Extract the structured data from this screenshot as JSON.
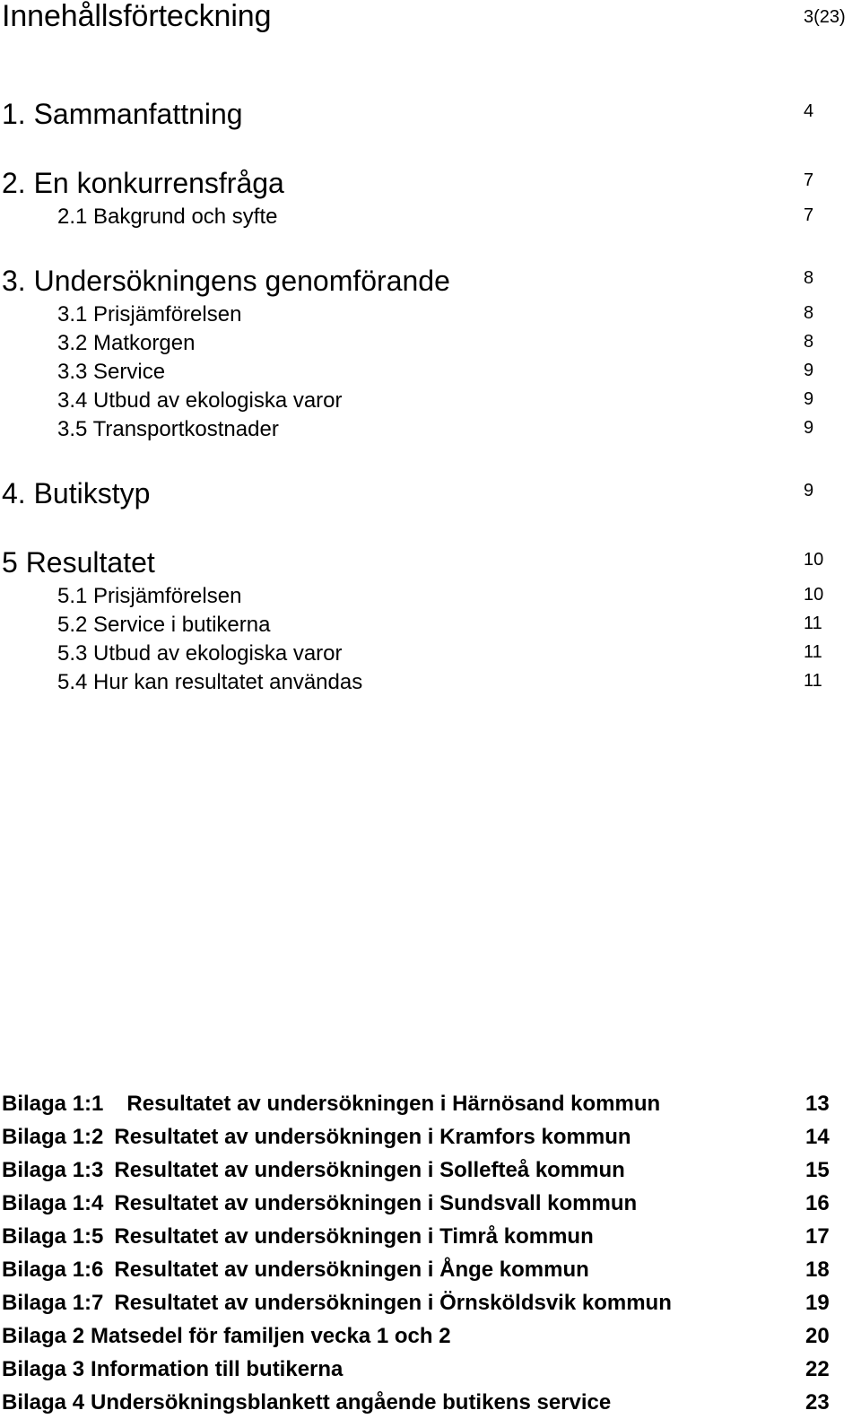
{
  "document": {
    "title": "Innehållsförteckning",
    "page_indicator": "3(23)"
  },
  "toc": {
    "entries": [
      {
        "label": "1. Sammanfattning",
        "page": "4",
        "level": 1
      },
      {
        "label": "2. En konkurrensfråga",
        "page": "7",
        "level": 1
      },
      {
        "label": "2.1 Bakgrund och syfte",
        "page": "7",
        "level": 2
      },
      {
        "label": "3. Undersökningens genomförande",
        "page": "8",
        "level": 1
      },
      {
        "label": "3.1 Prisjämförelsen",
        "page": "8",
        "level": 2
      },
      {
        "label": "3.2 Matkorgen",
        "page": "8",
        "level": 2
      },
      {
        "label": "3.3 Service",
        "page": "9",
        "level": 2
      },
      {
        "label": "3.4 Utbud av ekologiska varor",
        "page": "9",
        "level": 2
      },
      {
        "label": "3.5 Transportkostnader",
        "page": "9",
        "level": 2
      },
      {
        "label": "4. Butikstyp",
        "page": "9",
        "level": 1
      },
      {
        "label": "5 Resultatet",
        "page": "10",
        "level": 1
      },
      {
        "label": "5.1 Prisjämförelsen",
        "page": "10",
        "level": 2
      },
      {
        "label": "5.2 Service i butikerna",
        "page": "11",
        "level": 2
      },
      {
        "label": "5.3 Utbud av ekologiska varor",
        "page": "11",
        "level": 2
      },
      {
        "label": "5.4 Hur kan resultatet användas",
        "page": "11",
        "level": 2
      }
    ]
  },
  "appendix": {
    "entries": [
      {
        "label": "Bilaga 1:1",
        "text": "Resultatet av undersökningen i Härnösand kommun",
        "page": "13"
      },
      {
        "label": "Bilaga 1:2",
        "text": "Resultatet av undersökningen i Kramfors kommun",
        "page": "14"
      },
      {
        "label": "Bilaga 1:3",
        "text": "Resultatet av undersökningen i Sollefteå kommun",
        "page": "15"
      },
      {
        "label": "Bilaga 1:4",
        "text": "Resultatet av undersökningen i Sundsvall kommun",
        "page": "16"
      },
      {
        "label": "Bilaga 1:5",
        "text": "Resultatet av undersökningen i Timrå kommun",
        "page": "17"
      },
      {
        "label": "Bilaga 1:6",
        "text": "Resultatet av undersökningen i Ånge kommun",
        "page": "18"
      },
      {
        "label": "Bilaga 1:7",
        "text": "Resultatet av undersökningen i Örnsköldsvik kommun",
        "page": "19"
      },
      {
        "label": "Bilaga 2",
        "text": "Matsedel för familjen vecka 1 och 2",
        "page": "20"
      },
      {
        "label": "Bilaga 3",
        "text": "Information till butikerna",
        "page": "22"
      },
      {
        "label": "Bilaga 4",
        "text": "Undersökningsblankett angående butikens service",
        "page": "23"
      }
    ]
  }
}
